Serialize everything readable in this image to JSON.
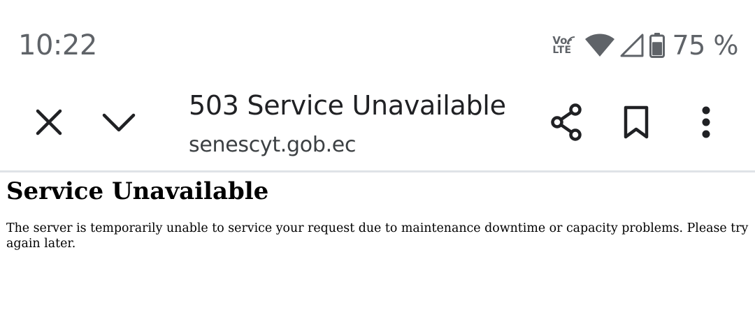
{
  "status_bar": {
    "time": "10:22",
    "network_label_top": "Vo",
    "network_label_bottom": "LTE",
    "battery_percent": "75 %",
    "battery_level": 0.75,
    "icons": [
      "volte-icon",
      "wifi-icon",
      "signal-icon",
      "battery-icon"
    ]
  },
  "toolbar": {
    "title": "503 Service Unavailable",
    "url": "senescyt.gob.ec",
    "icons": [
      "close-icon",
      "chevron-down-icon",
      "share-icon",
      "bookmark-icon",
      "more-vert-icon"
    ]
  },
  "page": {
    "heading": "Service Unavailable",
    "message": "The server is temporarily unable to service your request due to maintenance downtime or capacity problems. Please try again later."
  },
  "colors": {
    "status_text": "#5f6368",
    "toolbar_icon": "#202124",
    "divider": "#dfe3e7",
    "background": "#ffffff"
  }
}
